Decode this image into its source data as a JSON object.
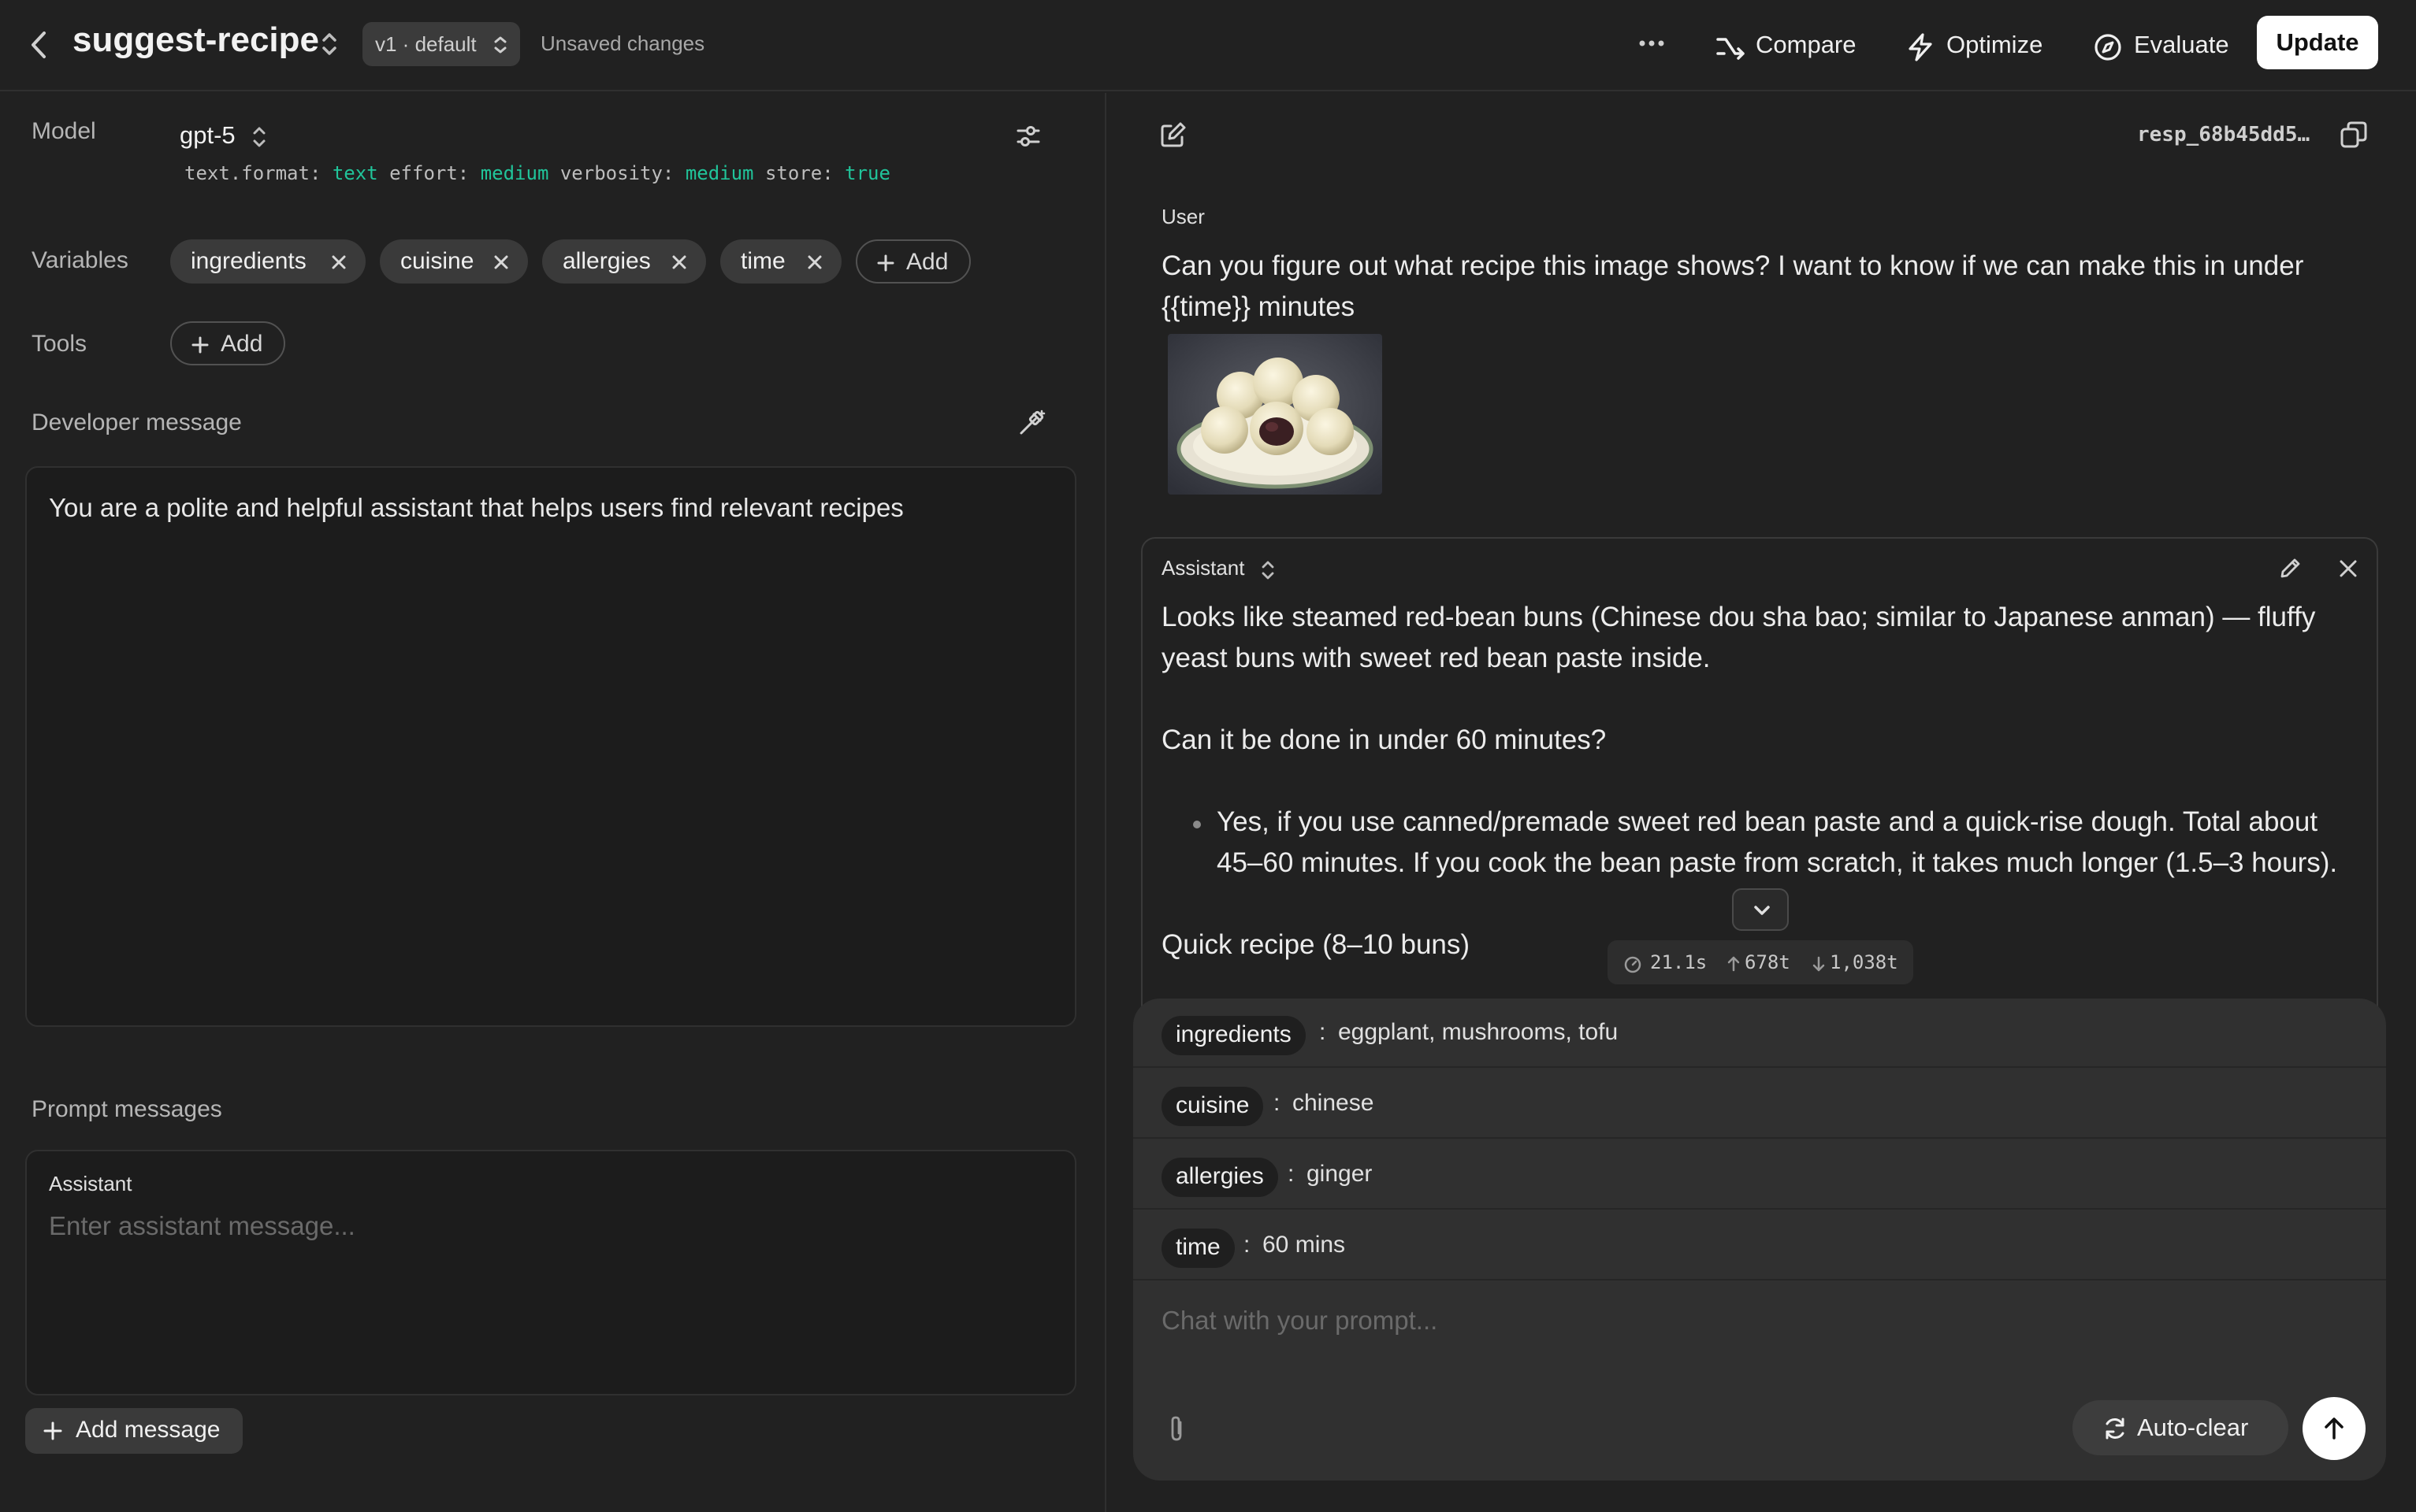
{
  "header": {
    "title": "suggest-recipe",
    "version": "v1 · default",
    "status": "Unsaved changes",
    "compare_label": "Compare",
    "optimize_label": "Optimize",
    "evaluate_label": "Evaluate",
    "update_label": "Update"
  },
  "config": {
    "model_label": "Model",
    "model_name": "gpt-5",
    "params": [
      {
        "key": "text.format:",
        "value": "text"
      },
      {
        "key": "effort:",
        "value": "medium"
      },
      {
        "key": "verbosity:",
        "value": "medium"
      },
      {
        "key": "store:",
        "value": "true"
      }
    ],
    "variables_label": "Variables",
    "variables": [
      "ingredients",
      "cuisine",
      "allergies",
      "time"
    ],
    "add_label": "Add",
    "tools_label": "Tools",
    "developer_message_label": "Developer message",
    "developer_message": "You are a polite and helpful assistant that helps users find relevant recipes",
    "prompt_messages_label": "Prompt messages",
    "prompt_role": "Assistant",
    "prompt_placeholder": "Enter assistant message...",
    "add_message_label": "Add message"
  },
  "conversation": {
    "response_id": "resp_68b45dd5…",
    "user_role": "User",
    "user_message": "Can you figure out what recipe this image shows? I want to know if we can make this in under {{time}} minutes",
    "assistant_role": "Assistant",
    "assistant_p1": "Looks like steamed red-bean buns (Chinese dou sha bao; similar to Japanese anman) — fluffy yeast buns with sweet red bean paste inside.",
    "assistant_p2": "Can it be done in under 60 minutes?",
    "assistant_bullet": "Yes, if you use canned/premade sweet red bean paste and a quick-rise dough. Total about 45–60 minutes. If you cook the bean paste from scratch, it takes much longer (1.5–3 hours).",
    "assistant_p3": "Quick recipe (8–10 buns)",
    "stats": {
      "time": "21.1s",
      "input_tokens": "678t",
      "output_tokens": "1,038t"
    }
  },
  "variable_values": [
    {
      "name": "ingredients",
      "value": "eggplant, mushrooms, tofu"
    },
    {
      "name": "cuisine",
      "value": "chinese"
    },
    {
      "name": "allergies",
      "value": "ginger"
    },
    {
      "name": "time",
      "value": "60 mins"
    }
  ],
  "chat": {
    "placeholder": "Chat with your prompt...",
    "autoclear_label": "Auto-clear"
  }
}
